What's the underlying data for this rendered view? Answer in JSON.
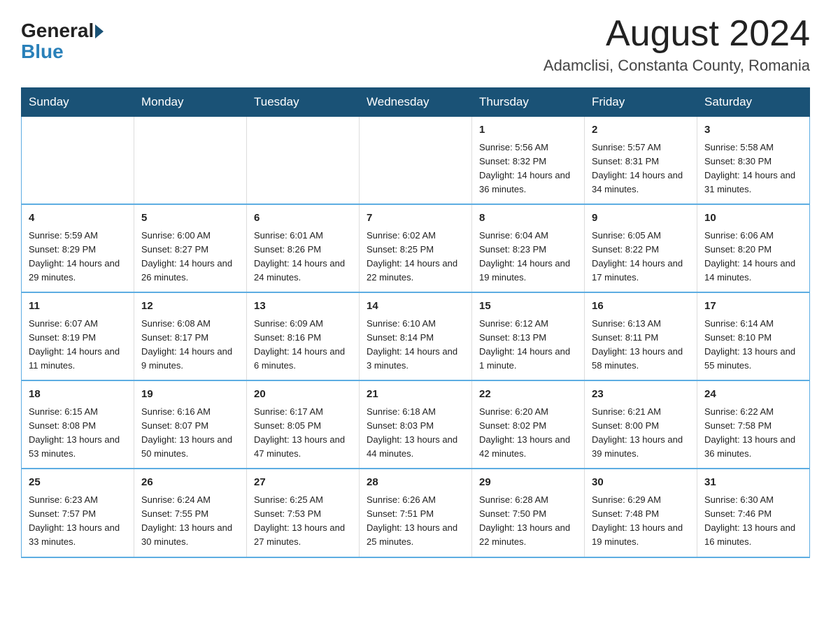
{
  "logo": {
    "text_general": "General",
    "text_blue": "Blue"
  },
  "title": "August 2024",
  "subtitle": "Adamclisi, Constanta County, Romania",
  "days_header": [
    "Sunday",
    "Monday",
    "Tuesday",
    "Wednesday",
    "Thursday",
    "Friday",
    "Saturday"
  ],
  "weeks": [
    [
      {
        "day": "",
        "info": ""
      },
      {
        "day": "",
        "info": ""
      },
      {
        "day": "",
        "info": ""
      },
      {
        "day": "",
        "info": ""
      },
      {
        "day": "1",
        "info": "Sunrise: 5:56 AM\nSunset: 8:32 PM\nDaylight: 14 hours and 36 minutes."
      },
      {
        "day": "2",
        "info": "Sunrise: 5:57 AM\nSunset: 8:31 PM\nDaylight: 14 hours and 34 minutes."
      },
      {
        "day": "3",
        "info": "Sunrise: 5:58 AM\nSunset: 8:30 PM\nDaylight: 14 hours and 31 minutes."
      }
    ],
    [
      {
        "day": "4",
        "info": "Sunrise: 5:59 AM\nSunset: 8:29 PM\nDaylight: 14 hours and 29 minutes."
      },
      {
        "day": "5",
        "info": "Sunrise: 6:00 AM\nSunset: 8:27 PM\nDaylight: 14 hours and 26 minutes."
      },
      {
        "day": "6",
        "info": "Sunrise: 6:01 AM\nSunset: 8:26 PM\nDaylight: 14 hours and 24 minutes."
      },
      {
        "day": "7",
        "info": "Sunrise: 6:02 AM\nSunset: 8:25 PM\nDaylight: 14 hours and 22 minutes."
      },
      {
        "day": "8",
        "info": "Sunrise: 6:04 AM\nSunset: 8:23 PM\nDaylight: 14 hours and 19 minutes."
      },
      {
        "day": "9",
        "info": "Sunrise: 6:05 AM\nSunset: 8:22 PM\nDaylight: 14 hours and 17 minutes."
      },
      {
        "day": "10",
        "info": "Sunrise: 6:06 AM\nSunset: 8:20 PM\nDaylight: 14 hours and 14 minutes."
      }
    ],
    [
      {
        "day": "11",
        "info": "Sunrise: 6:07 AM\nSunset: 8:19 PM\nDaylight: 14 hours and 11 minutes."
      },
      {
        "day": "12",
        "info": "Sunrise: 6:08 AM\nSunset: 8:17 PM\nDaylight: 14 hours and 9 minutes."
      },
      {
        "day": "13",
        "info": "Sunrise: 6:09 AM\nSunset: 8:16 PM\nDaylight: 14 hours and 6 minutes."
      },
      {
        "day": "14",
        "info": "Sunrise: 6:10 AM\nSunset: 8:14 PM\nDaylight: 14 hours and 3 minutes."
      },
      {
        "day": "15",
        "info": "Sunrise: 6:12 AM\nSunset: 8:13 PM\nDaylight: 14 hours and 1 minute."
      },
      {
        "day": "16",
        "info": "Sunrise: 6:13 AM\nSunset: 8:11 PM\nDaylight: 13 hours and 58 minutes."
      },
      {
        "day": "17",
        "info": "Sunrise: 6:14 AM\nSunset: 8:10 PM\nDaylight: 13 hours and 55 minutes."
      }
    ],
    [
      {
        "day": "18",
        "info": "Sunrise: 6:15 AM\nSunset: 8:08 PM\nDaylight: 13 hours and 53 minutes."
      },
      {
        "day": "19",
        "info": "Sunrise: 6:16 AM\nSunset: 8:07 PM\nDaylight: 13 hours and 50 minutes."
      },
      {
        "day": "20",
        "info": "Sunrise: 6:17 AM\nSunset: 8:05 PM\nDaylight: 13 hours and 47 minutes."
      },
      {
        "day": "21",
        "info": "Sunrise: 6:18 AM\nSunset: 8:03 PM\nDaylight: 13 hours and 44 minutes."
      },
      {
        "day": "22",
        "info": "Sunrise: 6:20 AM\nSunset: 8:02 PM\nDaylight: 13 hours and 42 minutes."
      },
      {
        "day": "23",
        "info": "Sunrise: 6:21 AM\nSunset: 8:00 PM\nDaylight: 13 hours and 39 minutes."
      },
      {
        "day": "24",
        "info": "Sunrise: 6:22 AM\nSunset: 7:58 PM\nDaylight: 13 hours and 36 minutes."
      }
    ],
    [
      {
        "day": "25",
        "info": "Sunrise: 6:23 AM\nSunset: 7:57 PM\nDaylight: 13 hours and 33 minutes."
      },
      {
        "day": "26",
        "info": "Sunrise: 6:24 AM\nSunset: 7:55 PM\nDaylight: 13 hours and 30 minutes."
      },
      {
        "day": "27",
        "info": "Sunrise: 6:25 AM\nSunset: 7:53 PM\nDaylight: 13 hours and 27 minutes."
      },
      {
        "day": "28",
        "info": "Sunrise: 6:26 AM\nSunset: 7:51 PM\nDaylight: 13 hours and 25 minutes."
      },
      {
        "day": "29",
        "info": "Sunrise: 6:28 AM\nSunset: 7:50 PM\nDaylight: 13 hours and 22 minutes."
      },
      {
        "day": "30",
        "info": "Sunrise: 6:29 AM\nSunset: 7:48 PM\nDaylight: 13 hours and 19 minutes."
      },
      {
        "day": "31",
        "info": "Sunrise: 6:30 AM\nSunset: 7:46 PM\nDaylight: 13 hours and 16 minutes."
      }
    ]
  ]
}
